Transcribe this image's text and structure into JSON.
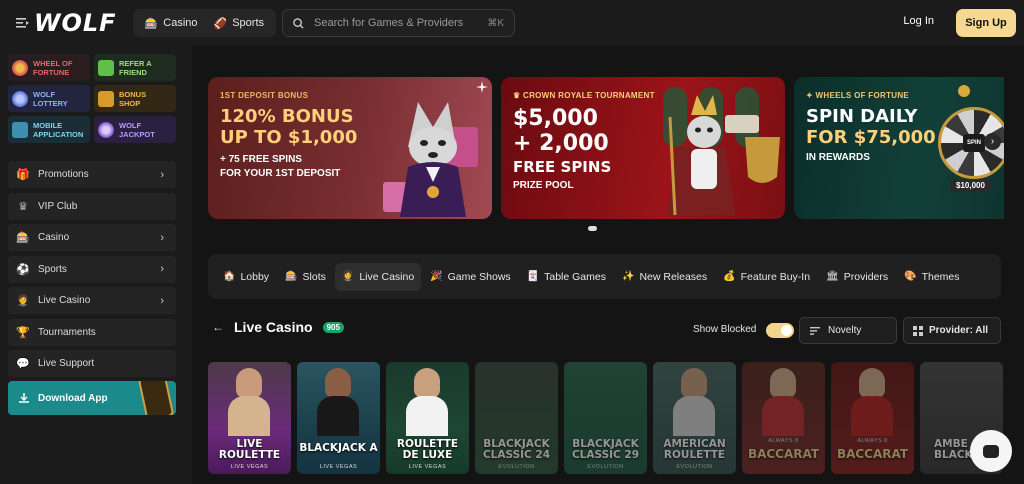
{
  "header": {
    "logo": "WOLF",
    "modes": [
      {
        "label": "Casino",
        "icon": "slot-icon"
      },
      {
        "label": "Sports",
        "icon": "ball-icon"
      }
    ],
    "search": {
      "placeholder": "Search for Games & Providers",
      "shortcut": "⌘K"
    },
    "login_label": "Log In",
    "signup_label": "Sign Up"
  },
  "sidebar": {
    "promos": [
      {
        "label_line1": "WHEEL OF",
        "label_line2": "FORTUNE",
        "color": "#e36868",
        "bg": "#3a1e22"
      },
      {
        "label_line1": "REFER A",
        "label_line2": "FRIEND",
        "color": "#9be07b",
        "bg": "#1e3320"
      },
      {
        "label_line1": "WOLF",
        "label_line2": "LOTTERY",
        "color": "#8fb1ff",
        "bg": "#232a4a"
      },
      {
        "label_line1": "BONUS",
        "label_line2": "SHOP",
        "color": "#f2b94b",
        "bg": "#3f2f12"
      },
      {
        "label_line1": "MOBILE",
        "label_line2": "APPLICATION",
        "color": "#7fd4ef",
        "bg": "#1b3644"
      },
      {
        "label_line1": "WOLF",
        "label_line2": "JACKPOT",
        "color": "#b99cff",
        "bg": "#2e2146"
      }
    ],
    "nav": [
      {
        "label": "Promotions",
        "icon": "gift-icon",
        "chevron": true
      },
      {
        "label": "VIP Club",
        "icon": "crown-icon",
        "chevron": false
      },
      {
        "label": "Casino",
        "icon": "slot-machine-icon",
        "chevron": true
      },
      {
        "label": "Sports",
        "icon": "ball-icon",
        "chevron": true
      },
      {
        "label": "Live Casino",
        "icon": "dealer-icon",
        "chevron": true
      },
      {
        "label": "Tournaments",
        "icon": "trophy-icon",
        "chevron": false
      },
      {
        "label": "Live Support",
        "icon": "chat-icon",
        "chevron": false
      }
    ],
    "download_label": "Download App"
  },
  "banners": [
    {
      "kicker": "1ST DEPOSIT BONUS",
      "headline_line1": "120% BONUS",
      "headline_line2": "UP TO $1,000",
      "sub_line1": "+ 75 FREE SPINS",
      "sub_line2": "FOR YOUR 1ST DEPOSIT",
      "kicker_color": "#f0b66a",
      "headline_color": "#ffcf7a"
    },
    {
      "kicker": "CROWN ROYALE TOURNAMENT",
      "headline_line1": "$5,000",
      "headline_line2": "+ 2,000",
      "headline_line3": "FREE SPINS",
      "sub_line1": "PRIZE POOL",
      "kicker_color": "#f5d27e"
    },
    {
      "kicker": "WHEELS OF FORTUNE",
      "headline_line1": "SPIN DAILY",
      "headline_line2": "FOR $75,000",
      "sub_line1": "IN REWARDS",
      "wheel_label": "SPIN",
      "wheel_prize": "$10,000",
      "kicker_color": "#f0c774"
    }
  ],
  "categories": [
    {
      "label": "Lobby",
      "icon": "home-icon",
      "active": false
    },
    {
      "label": "Slots",
      "icon": "slot-icon",
      "active": false
    },
    {
      "label": "Live Casino",
      "icon": "dealer-icon",
      "active": true
    },
    {
      "label": "Game Shows",
      "icon": "show-icon",
      "active": false
    },
    {
      "label": "Table Games",
      "icon": "cards-icon",
      "active": false
    },
    {
      "label": "New Releases",
      "icon": "new-icon",
      "active": false
    },
    {
      "label": "Feature Buy-In",
      "icon": "buy-icon",
      "active": false
    },
    {
      "label": "Providers",
      "icon": "provider-icon",
      "active": false
    },
    {
      "label": "Themes",
      "icon": "theme-icon",
      "active": false
    }
  ],
  "section": {
    "title": "Live Casino",
    "count": "905",
    "show_blocked_label": "Show Blocked",
    "show_blocked_on": true,
    "sort_label": "Novelty",
    "provider_label": "Provider: All"
  },
  "games": [
    {
      "title_line1": "LIVE",
      "title_line2": "ROULETTE",
      "provider": "LIVE VEGAS",
      "bg": "#5a2a6e",
      "dim": false
    },
    {
      "title_line1": "BLACKJACK A",
      "title_line2": "",
      "provider": "LIVE VEGAS",
      "bg": "#1f3f4e",
      "dim": false
    },
    {
      "title_line1": "ROULETTE",
      "title_line2": "DE LUXE",
      "provider": "LIVE VEGAS",
      "bg": "#1c3a2c",
      "dim": false
    },
    {
      "title_line1": "BLACKJACK",
      "title_line2": "CLASSIC 24",
      "provider": "EVOLUTION",
      "bg": "#2f4536",
      "dim": true
    },
    {
      "title_line1": "BLACKJACK",
      "title_line2": "CLASSIC 29",
      "provider": "EVOLUTION",
      "bg": "#285a48",
      "dim": true
    },
    {
      "title_line1": "AMERICAN",
      "title_line2": "ROULETTE",
      "provider": "EVOLUTION",
      "bg": "#3f5a55",
      "dim": true
    },
    {
      "title_line1": "BACCARAT",
      "title_line2": "",
      "provider": "ALWAYS 8",
      "bg": "#6e2a2a",
      "dim": true
    },
    {
      "title_line1": "BACCARAT",
      "title_line2": "",
      "provider": "ALWAYS 8",
      "bg": "#7a2222",
      "dim": true
    },
    {
      "title_line1": "AMBE",
      "title_line2": "BLACKJA",
      "provider": "",
      "bg": "#4e4e4e",
      "dim": true
    }
  ]
}
